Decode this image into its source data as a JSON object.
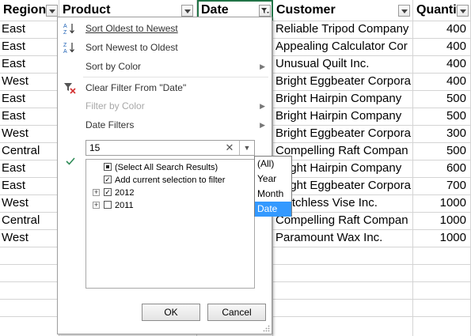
{
  "columns": {
    "region": "Region",
    "product": "Product",
    "date": "Date",
    "customer": "Customer",
    "quantity": "Quantity"
  },
  "rows": [
    {
      "region": "East",
      "customer": "Reliable Tripod Company",
      "quantity": "400"
    },
    {
      "region": "East",
      "customer": "Appealing Calculator Cor",
      "quantity": "400"
    },
    {
      "region": "East",
      "customer": "Unusual Quilt Inc.",
      "quantity": "400"
    },
    {
      "region": "West",
      "customer": "Bright Eggbeater Corpora",
      "quantity": "400"
    },
    {
      "region": "East",
      "customer": "Bright Hairpin Company",
      "quantity": "500"
    },
    {
      "region": "East",
      "customer": "Bright Hairpin Company",
      "quantity": "500"
    },
    {
      "region": "West",
      "customer": "Bright Eggbeater Corpora",
      "quantity": "300"
    },
    {
      "region": "Central",
      "customer": "Compelling Raft Compan",
      "quantity": "500"
    },
    {
      "region": "East",
      "customer": "Bright Hairpin Company",
      "quantity": "600"
    },
    {
      "region": "East",
      "customer": "Bright Eggbeater Corpora",
      "quantity": "700"
    },
    {
      "region": "West",
      "customer": "Matchless Vise Inc.",
      "quantity": "1000"
    },
    {
      "region": "Central",
      "customer": "Compelling Raft Compan",
      "quantity": "1000"
    },
    {
      "region": "West",
      "customer": "Paramount Wax Inc.",
      "quantity": "1000"
    }
  ],
  "menu": {
    "sort_asc": "Sort Oldest to Newest",
    "sort_desc": "Sort Newest to Oldest",
    "sort_color": "Sort by Color",
    "clear_filter": "Clear Filter From \"Date\"",
    "filter_color": "Filter by Color",
    "date_filters": "Date Filters",
    "search_value": "15",
    "select_all": "(Select All Search Results)",
    "add_selection": "Add current selection to filter",
    "year_2012": "2012",
    "year_2011": "2011",
    "ok": "OK",
    "cancel": "Cancel"
  },
  "search_scope": {
    "options": [
      "(All)",
      "Year",
      "Month",
      "Date"
    ],
    "selected": "Date"
  },
  "colors": {
    "grid": "#d4d4d4",
    "active_border": "#217346",
    "selection": "#3399ff",
    "checkmark": "#2e8b57"
  }
}
